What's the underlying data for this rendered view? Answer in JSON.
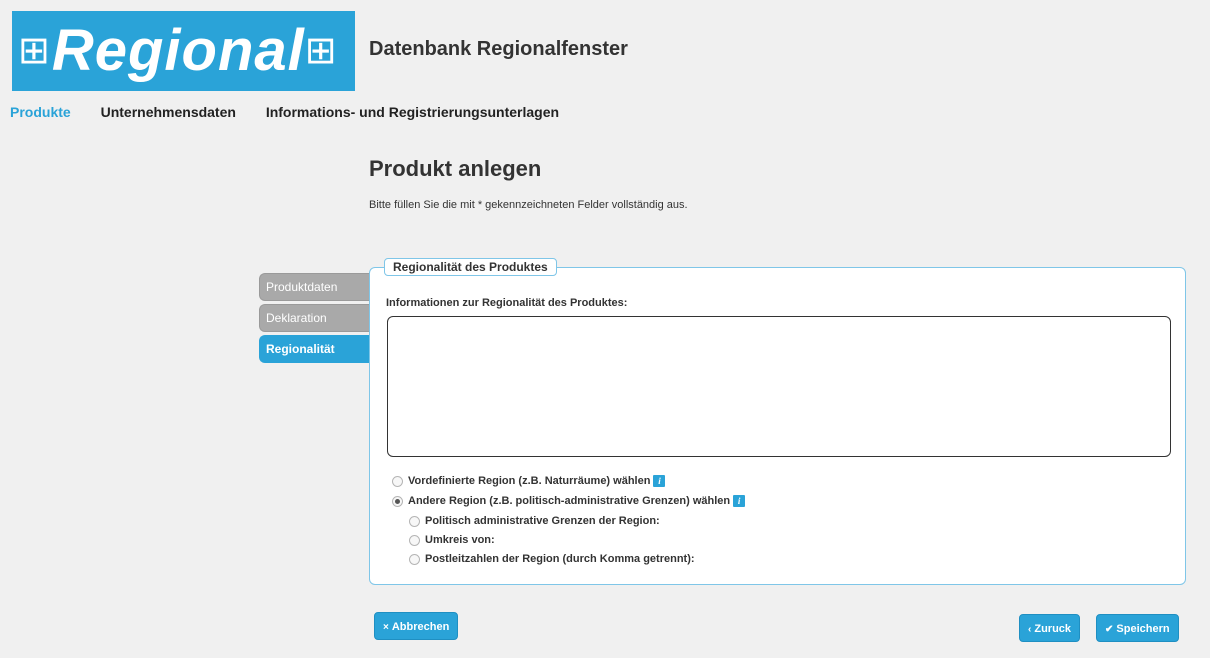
{
  "logo": {
    "text": "Regional",
    "left_icon": "window-icon",
    "right_icon": "window-icon"
  },
  "site_title": "Datenbank Regionalfenster",
  "topnav": [
    {
      "label": "Produkte",
      "active": true
    },
    {
      "label": "Unternehmensdaten",
      "active": false
    },
    {
      "label": "Informations- und Registrierungsunterlagen",
      "active": false
    }
  ],
  "page": {
    "heading": "Produkt anlegen",
    "subtext": "Bitte füllen Sie die mit * gekennzeichneten Felder vollständig aus."
  },
  "sidetabs": [
    {
      "label": "Produktdaten",
      "active": false
    },
    {
      "label": "Deklaration",
      "active": false
    },
    {
      "label": "Regionalität",
      "active": true
    }
  ],
  "form": {
    "legend": "Regionalität des Produktes",
    "textarea_label": "Informationen zur Regionalität des Produktes:",
    "textarea_value": "",
    "options": [
      {
        "label": "Vordefinierte Region (z.B. Naturräume) wählen",
        "checked": false,
        "info": true
      },
      {
        "label": "Andere Region (z.B. politisch-administrative Grenzen) wählen",
        "checked": true,
        "info": true
      }
    ],
    "sub_options": [
      {
        "label": "Politisch administrative Grenzen der Region:",
        "checked": false
      },
      {
        "label": "Umkreis von:",
        "checked": false
      },
      {
        "label": "Postleitzahlen der Region (durch Komma getrennt):",
        "checked": false
      }
    ]
  },
  "buttons": {
    "cancel": {
      "icon": "x-icon",
      "label": "Abbrechen"
    },
    "back": {
      "icon": "chevron-left-icon",
      "label": "Zuruck"
    },
    "save": {
      "icon": "check-icon",
      "label": "Speichern"
    }
  },
  "colors": {
    "accent": "#2aa3d8",
    "inactive_tab": "#a9a9a9",
    "background": "#f0f0f0"
  }
}
